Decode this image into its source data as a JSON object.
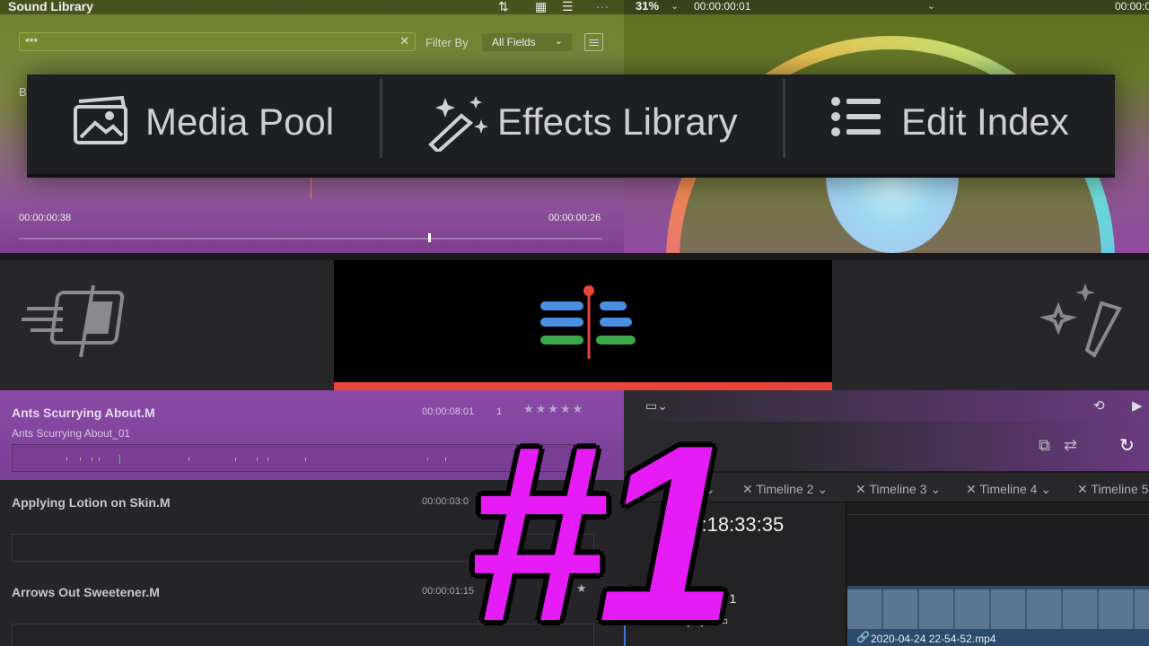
{
  "sound_library": {
    "title": "Sound Library",
    "search_value": "***",
    "filter_label": "Filter By",
    "filter_value": "All Fields",
    "time_left": "00:00:00:38",
    "time_right": "00:00:00:26",
    "partial_b": "B"
  },
  "viewer": {
    "zoom": "31%",
    "timecode": "00:00:00:01",
    "timecode_right": "00:00:0"
  },
  "tabs": [
    {
      "label": "Media Pool",
      "icon": "image-icon"
    },
    {
      "label": "Effects Library",
      "icon": "magic-wand-icon"
    },
    {
      "label": "Edit Index",
      "icon": "list-icon"
    }
  ],
  "pages": [
    {
      "name": "Cut",
      "icon": "cut-page-icon"
    },
    {
      "name": "Edit",
      "icon": "edit-page-icon",
      "active": true
    },
    {
      "name": "Fusion",
      "icon": "fusion-page-icon"
    }
  ],
  "sounds": [
    {
      "name": "Ants Scurrying About.M",
      "sub": "Ants Scurrying About_01",
      "duration": "00:00:08:01",
      "channels": "1",
      "stars": "★★★★★"
    },
    {
      "name": "Applying Lotion on Skin.M",
      "sub": "",
      "duration": "00:00:03:0",
      "channels": "",
      "stars": ""
    },
    {
      "name": "Arrows Out Sweetener.M",
      "sub": "",
      "duration": "00:00:01:15",
      "channels": "",
      "stars": "★"
    }
  ],
  "timeline": {
    "tabs": [
      "me 1",
      "Timeline 2",
      "Timeline 3",
      "Timeline 4",
      "Timeline 5"
    ],
    "timecode": "00:18:33:35",
    "track": "Video 1",
    "clip_name": "2020-04-24 22-54-52.mp4"
  },
  "overlay": {
    "text": "#1",
    "color": "#e51cf5"
  },
  "colors": {
    "active_page": "#e8453a",
    "accent_purple": "#8a4aa6"
  }
}
